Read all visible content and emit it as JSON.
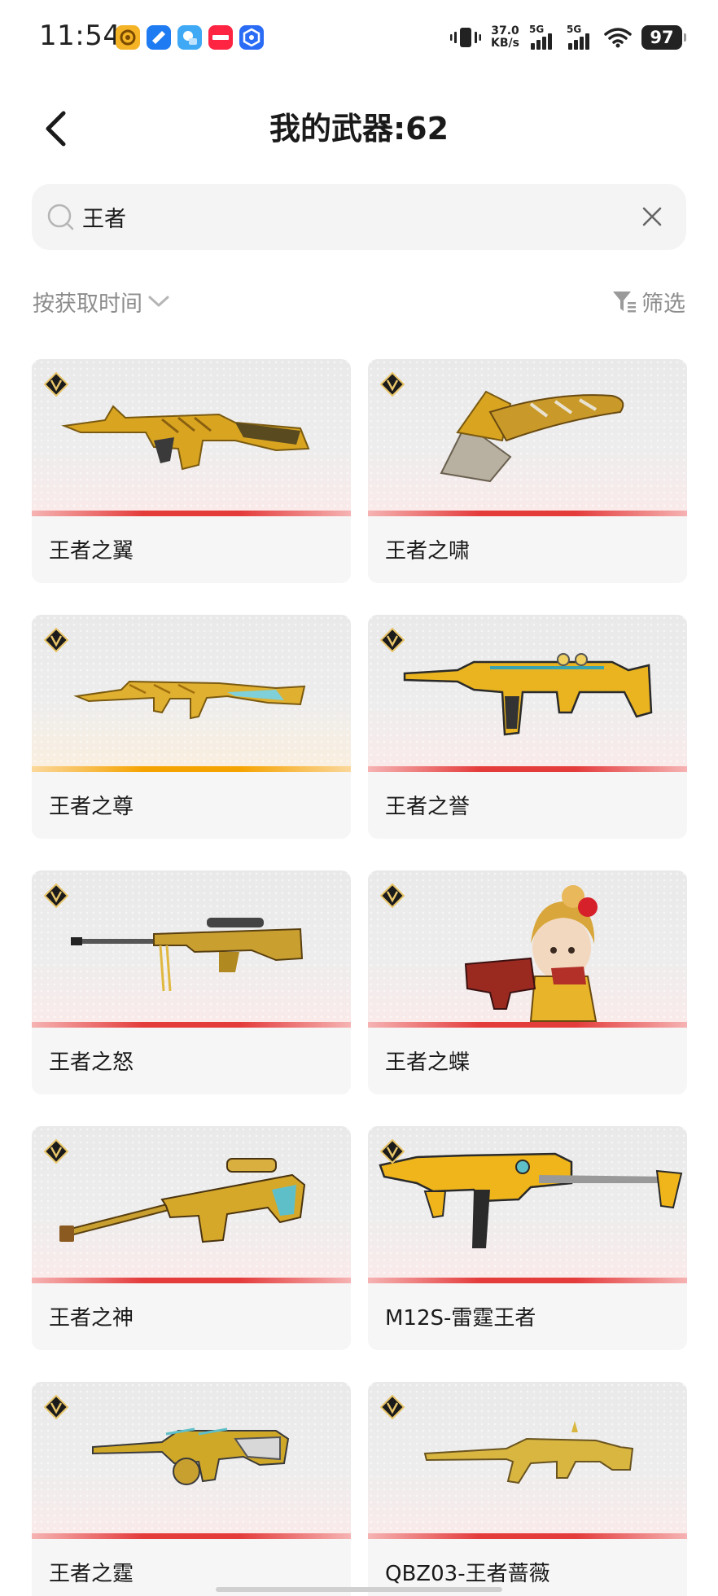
{
  "status_bar": {
    "time": "11:54",
    "net_speed_value": "37.0",
    "net_speed_unit": "KB/s",
    "signal_1": "5G",
    "signal_2": "5G",
    "battery": "97",
    "notification_icons": [
      "app-orange-icon",
      "app-blue-icon",
      "app-lightblue-icon",
      "xiaohongshu-icon",
      "app-blue2-icon"
    ]
  },
  "header": {
    "title": "我的武器:62"
  },
  "search": {
    "value": "王者",
    "placeholder": ""
  },
  "toolbar": {
    "sort_label": "按获取时间",
    "filter_label": "筛选"
  },
  "weapons": [
    {
      "name": "王者之翼",
      "rarity": "red"
    },
    {
      "name": "王者之啸",
      "rarity": "red"
    },
    {
      "name": "王者之尊",
      "rarity": "gold"
    },
    {
      "name": "王者之誉",
      "rarity": "red"
    },
    {
      "name": "王者之怒",
      "rarity": "red"
    },
    {
      "name": "王者之蝶",
      "rarity": "red"
    },
    {
      "name": "王者之神",
      "rarity": "red"
    },
    {
      "name": "M12S-雷霆王者",
      "rarity": "red"
    },
    {
      "name": "王者之霆",
      "rarity": "red"
    },
    {
      "name": "QBZ03-王者蔷薇",
      "rarity": "red"
    }
  ],
  "colors": {
    "rarity_red": "#e43b3b",
    "rarity_gold": "#f5a300",
    "weapon_gold": "#d9a520",
    "muted_text": "#8c8c8c"
  }
}
